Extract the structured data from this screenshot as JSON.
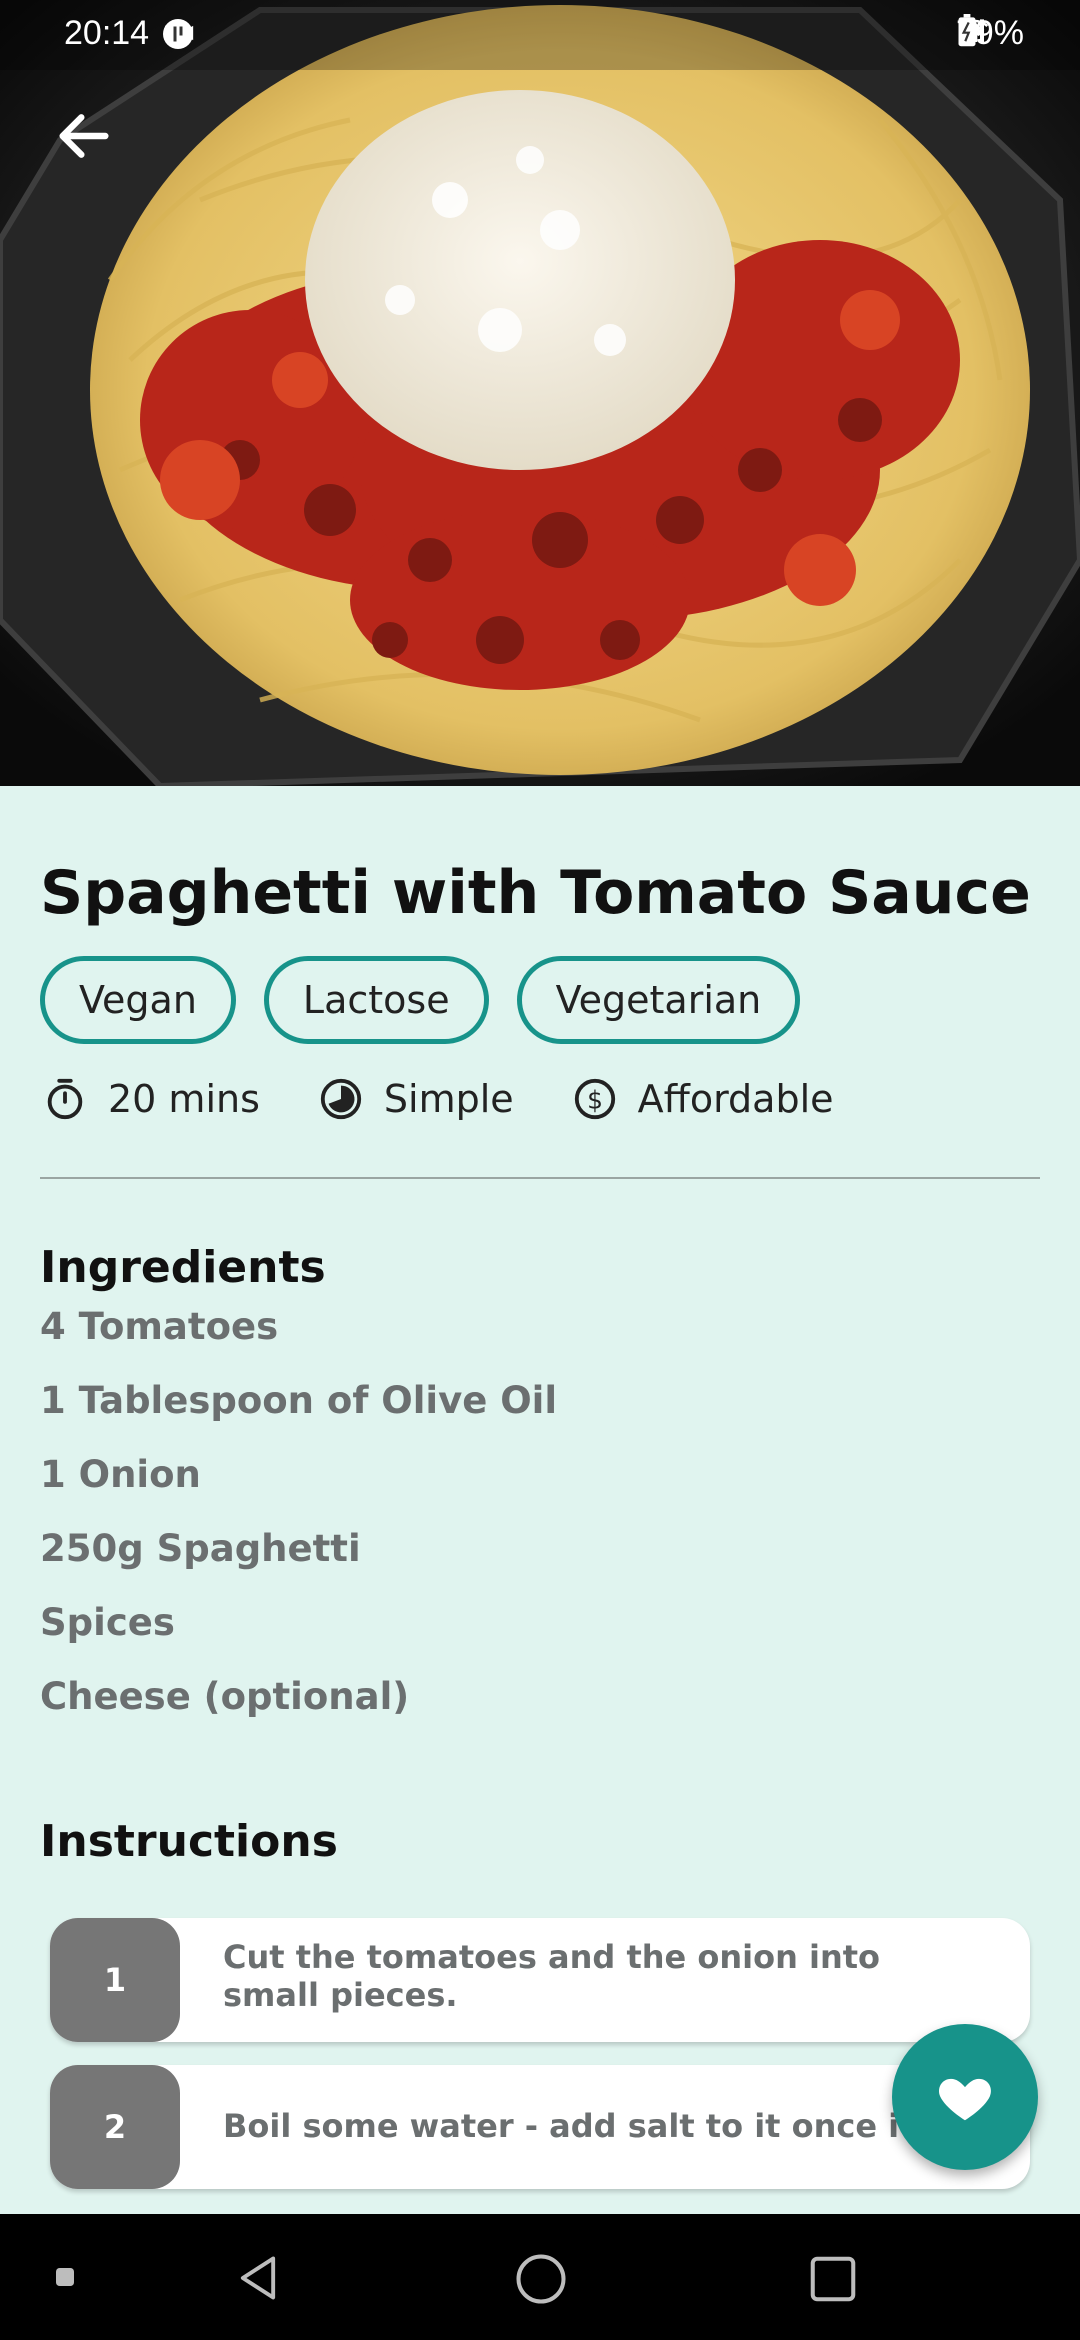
{
  "status_bar": {
    "time": "20:14",
    "battery": "79%",
    "icons_left": [
      "usb-icon",
      "camera-icon",
      "app-icon"
    ],
    "icons_right": [
      "mute-icon",
      "wifi-icon",
      "signal-icon",
      "battery-icon"
    ]
  },
  "recipe": {
    "title": "Spaghetti with Tomato Sauce",
    "tags": [
      "Vegan",
      "Lactose",
      "Vegetarian"
    ],
    "meta": {
      "duration": "20 mins",
      "complexity": "Simple",
      "affordability": "Affordable"
    },
    "ingredients_heading": "Ingredients",
    "ingredients": [
      "4 Tomatoes",
      "1 Tablespoon of Olive Oil",
      "1 Onion",
      "250g Spaghetti",
      "Spices",
      "Cheese (optional)"
    ],
    "instructions_heading": "Instructions",
    "steps": [
      {
        "number": "1",
        "text": "Cut the tomatoes and the onion into small pieces."
      },
      {
        "number": "2",
        "text": "Boil some water - add salt to it once it boils."
      }
    ]
  },
  "colors": {
    "accent": "#17938a",
    "background": "#e0f4ef",
    "muted_text": "#6b6f70",
    "step_badge": "#767676"
  }
}
